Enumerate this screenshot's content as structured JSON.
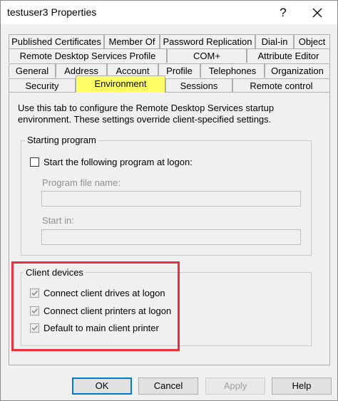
{
  "window": {
    "title": "testuser3 Properties",
    "help_glyph": "?",
    "close_glyph": "✕"
  },
  "tabs": {
    "row1": [
      "Published Certificates",
      "Member Of",
      "Password Replication",
      "Dial-in",
      "Object"
    ],
    "row2": [
      "Remote Desktop Services Profile",
      "COM+",
      "Attribute Editor"
    ],
    "row3": [
      "General",
      "Address",
      "Account",
      "Profile",
      "Telephones",
      "Organization"
    ],
    "row4": [
      "Security",
      "Environment",
      "Sessions",
      "Remote control"
    ],
    "active": "Environment"
  },
  "environment": {
    "description": "Use this tab to configure the Remote Desktop Services startup environment. These settings override client-specified settings.",
    "starting_program": {
      "legend": "Starting program",
      "checkbox_label": "Start the following program at logon:",
      "checked": false,
      "program_file_label": "Program file name:",
      "program_file_value": "",
      "start_in_label": "Start in:",
      "start_in_value": ""
    },
    "client_devices": {
      "legend": "Client devices",
      "items": [
        {
          "label": "Connect client drives at logon",
          "checked": true
        },
        {
          "label": "Connect client printers at logon",
          "checked": true
        },
        {
          "label": "Default to main client printer",
          "checked": true
        }
      ]
    }
  },
  "buttons": {
    "ok": "OK",
    "cancel": "Cancel",
    "apply": "Apply",
    "help": "Help"
  },
  "colors": {
    "active_tab": "#ffff66",
    "highlight_border": "#e8313a",
    "default_button_border": "#0078d7"
  }
}
